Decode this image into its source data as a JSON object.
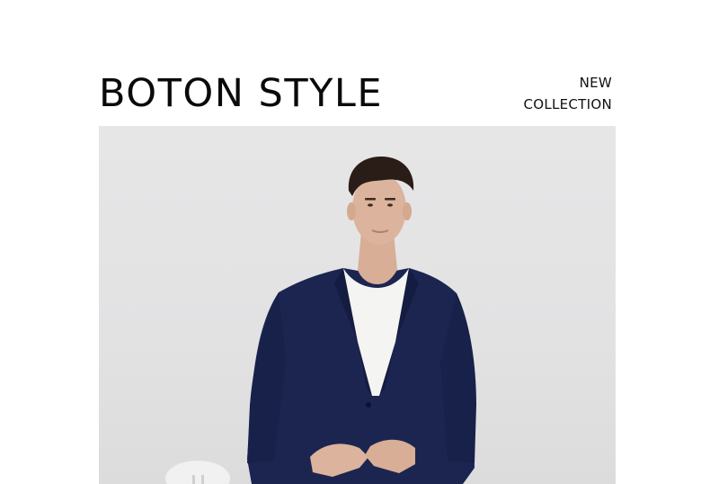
{
  "header": {
    "brand": "BOTON STYLE",
    "tag_line_1": "NEW",
    "tag_line_2": "COLLECTION"
  },
  "hero": {
    "subject": "model-in-navy-blazer",
    "colors": {
      "background": "#e3e3e4",
      "blazer": "#1b2550",
      "shirt": "#f4f4f2",
      "hair": "#2a1d17",
      "skin": "#dcb39c"
    }
  }
}
